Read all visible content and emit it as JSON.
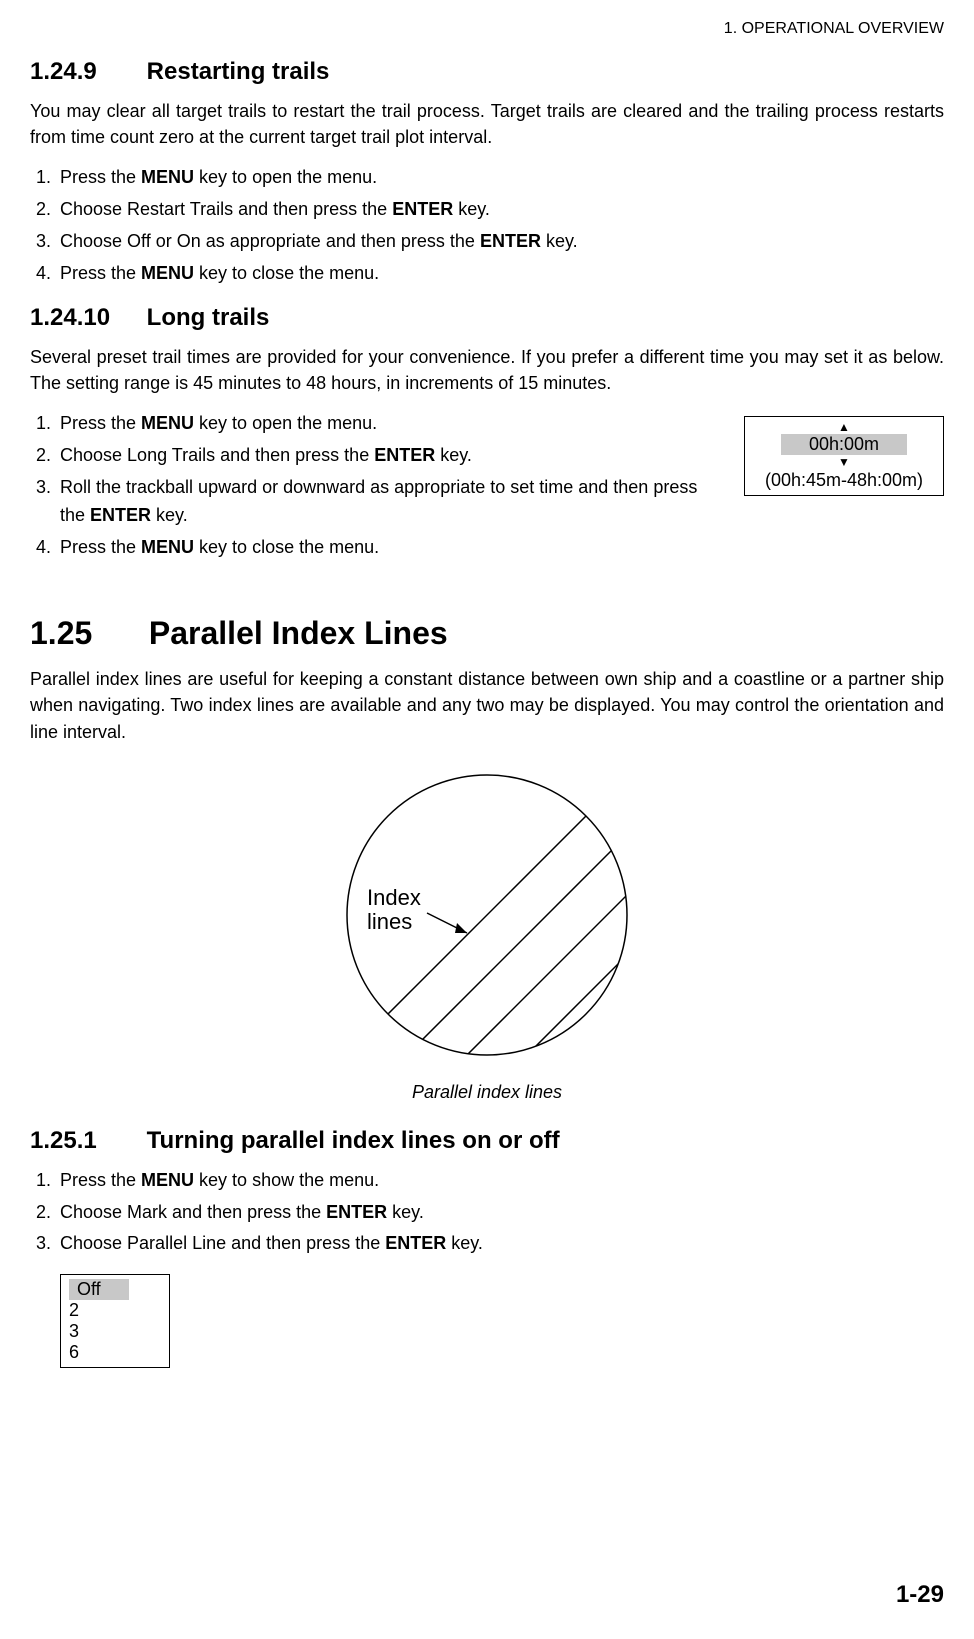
{
  "header": {
    "chapter": "1. OPERATIONAL OVERVIEW"
  },
  "s1": {
    "num": "1.24.9",
    "title": "Restarting trails",
    "para": "You may clear all target trails to restart the trail process. Target trails are cleared and the trailing process restarts from time count zero at the current target trail plot interval.",
    "steps": {
      "s1a": "Press the ",
      "s1b": "MENU",
      "s1c": " key to open the menu.",
      "s2a": "Choose Restart Trails and then press the ",
      "s2b": "ENTER",
      "s2c": " key.",
      "s3a": "Choose Off or On as appropriate and then press the ",
      "s3b": "ENTER",
      "s3c": " key.",
      "s4a": "Press the ",
      "s4b": "MENU",
      "s4c": " key to close the menu."
    }
  },
  "s2": {
    "num": "1.24.10",
    "title": "Long trails",
    "para": "Several preset trail times are provided for your convenience. If you prefer a different time you may set it as below. The setting range is 45 minutes to 48 hours, in increments of 15 minutes.",
    "steps": {
      "s1a": "Press the ",
      "s1b": "MENU",
      "s1c": " key to open the menu.",
      "s2a": "Choose Long Trails and then press the ",
      "s2b": "ENTER",
      "s2c": " key.",
      "s3a": "Roll the trackball upward or downward as appropriate to set time and then press the ",
      "s3b": "ENTER",
      "s3c": " key.",
      "s4a": "Press the ",
      "s4b": "MENU",
      "s4c": " key to close the menu."
    },
    "timebox": {
      "value": "00h:00m",
      "range": "(00h:45m-48h:00m)"
    }
  },
  "s3": {
    "num": "1.25",
    "title": "Parallel Index Lines",
    "para": "Parallel index lines are useful for keeping a constant distance between own ship and a coastline or a partner ship when navigating. Two index lines are available and any two may be displayed. You may control the orientation and line interval.",
    "fig_label1": "Index",
    "fig_label2": "lines",
    "caption": "Parallel index lines"
  },
  "s4": {
    "num": "1.25.1",
    "title": "Turning parallel index lines on or off",
    "steps": {
      "s1a": "Press the ",
      "s1b": "MENU",
      "s1c": " key to show the menu.",
      "s2a": "Choose Mark and then press the ",
      "s2b": "ENTER",
      "s2c": " key.",
      "s3a": "Choose Parallel Line and then press the ",
      "s3b": "ENTER",
      "s3c": " key."
    },
    "options": {
      "o1": "Off",
      "o2": "2",
      "o3": "3",
      "o4": "6"
    }
  },
  "footer": {
    "page": "1-29"
  }
}
